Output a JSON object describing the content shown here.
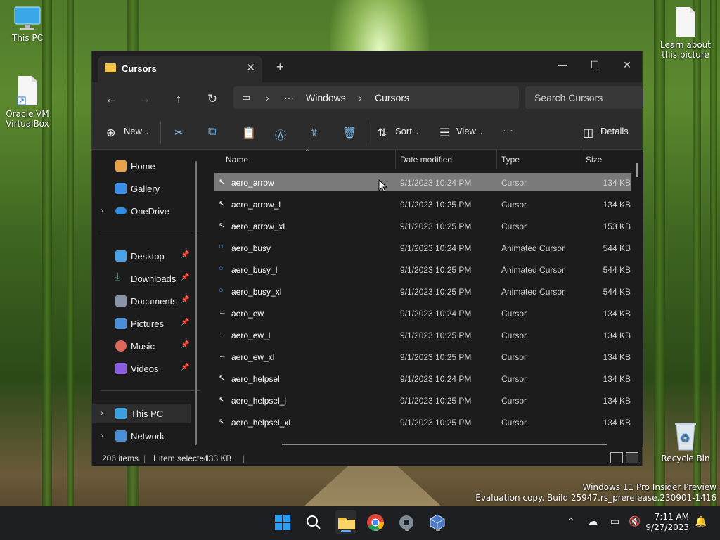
{
  "desktop": {
    "icons": [
      {
        "label": "This PC",
        "icon": "monitor-icon"
      },
      {
        "label": "Oracle VM VirtualBox",
        "icon": "shortcut-file-icon"
      },
      {
        "label": "Learn about this picture",
        "icon": "file-icon"
      },
      {
        "label": "Recycle Bin",
        "icon": "recycle-bin-icon"
      }
    ],
    "watermark_line1": "Windows 11 Pro Insider Preview",
    "watermark_line2": "Evaluation copy. Build 25947.rs_prerelease.230901-1416"
  },
  "window": {
    "tab_title": "Cursors",
    "new_tab": "+",
    "controls": {
      "minimize": "—",
      "maximize": "☐",
      "close": "✕"
    },
    "breadcrumb": [
      "Windows",
      "Cursors"
    ],
    "breadcrumb_more": "···",
    "search_placeholder": "Search Cursors",
    "commands": {
      "new": "New",
      "sort": "Sort",
      "view": "View",
      "more": "···",
      "details": "Details"
    },
    "sidebar": {
      "top": [
        {
          "label": "Home",
          "icon": "home-icon",
          "color": "#e8a24a"
        },
        {
          "label": "Gallery",
          "icon": "gallery-icon",
          "color": "#3b8ee8"
        },
        {
          "label": "OneDrive",
          "icon": "onedrive-icon",
          "color": "#2f8fe6"
        }
      ],
      "quick": [
        {
          "label": "Desktop",
          "icon": "desktop-icon",
          "color": "#4aa3e8"
        },
        {
          "label": "Downloads",
          "icon": "downloads-icon",
          "color": "#35b572"
        },
        {
          "label": "Documents",
          "icon": "documents-icon",
          "color": "#8a94a8"
        },
        {
          "label": "Pictures",
          "icon": "pictures-icon",
          "color": "#4a8fd8"
        },
        {
          "label": "Music",
          "icon": "music-icon",
          "color": "#e0685a"
        },
        {
          "label": "Videos",
          "icon": "videos-icon",
          "color": "#8a5ce0"
        }
      ],
      "bottom": [
        {
          "label": "This PC",
          "icon": "this-pc-icon",
          "color": "#3aa0e0"
        },
        {
          "label": "Network",
          "icon": "network-icon",
          "color": "#4a90d8"
        }
      ]
    },
    "columns": {
      "name": "Name",
      "date": "Date modified",
      "type": "Type",
      "size": "Size"
    },
    "files": [
      {
        "name": "aero_arrow",
        "date": "9/1/2023 10:24 PM",
        "type": "Cursor",
        "size": "134 KB",
        "glyph": "↖"
      },
      {
        "name": "aero_arrow_l",
        "date": "9/1/2023 10:25 PM",
        "type": "Cursor",
        "size": "134 KB",
        "glyph": "↖"
      },
      {
        "name": "aero_arrow_xl",
        "date": "9/1/2023 10:25 PM",
        "type": "Cursor",
        "size": "153 KB",
        "glyph": "↖"
      },
      {
        "name": "aero_busy",
        "date": "9/1/2023 10:24 PM",
        "type": "Animated Cursor",
        "size": "544 KB",
        "glyph": "○"
      },
      {
        "name": "aero_busy_l",
        "date": "9/1/2023 10:25 PM",
        "type": "Animated Cursor",
        "size": "544 KB",
        "glyph": "○"
      },
      {
        "name": "aero_busy_xl",
        "date": "9/1/2023 10:25 PM",
        "type": "Animated Cursor",
        "size": "544 KB",
        "glyph": "○"
      },
      {
        "name": "aero_ew",
        "date": "9/1/2023 10:24 PM",
        "type": "Cursor",
        "size": "134 KB",
        "glyph": "↔"
      },
      {
        "name": "aero_ew_l",
        "date": "9/1/2023 10:25 PM",
        "type": "Cursor",
        "size": "134 KB",
        "glyph": "↔"
      },
      {
        "name": "aero_ew_xl",
        "date": "9/1/2023 10:25 PM",
        "type": "Cursor",
        "size": "134 KB",
        "glyph": "↔"
      },
      {
        "name": "aero_helpsel",
        "date": "9/1/2023 10:24 PM",
        "type": "Cursor",
        "size": "134 KB",
        "glyph": "↖"
      },
      {
        "name": "aero_helpsel_l",
        "date": "9/1/2023 10:25 PM",
        "type": "Cursor",
        "size": "134 KB",
        "glyph": "↖"
      },
      {
        "name": "aero_helpsel_xl",
        "date": "9/1/2023 10:25 PM",
        "type": "Cursor",
        "size": "134 KB",
        "glyph": "↖"
      }
    ],
    "status": {
      "count": "206 items",
      "selection": "1 item selected",
      "size": "133 KB"
    }
  },
  "taskbar": {
    "apps": [
      "start-icon",
      "search-icon",
      "file-explorer-icon",
      "chrome-icon",
      "settings-icon",
      "virtualbox-icon"
    ],
    "time": "7:11 AM",
    "date": "9/27/2023"
  }
}
